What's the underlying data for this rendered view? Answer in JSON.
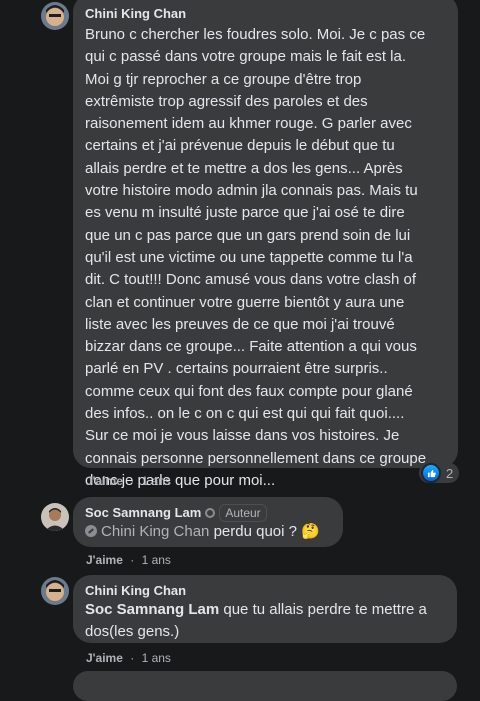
{
  "comments": [
    {
      "author": "Chini King Chan",
      "lines": [
        "Bruno c chercher les foudres solo. Moi. Je c pas ce",
        "qui c passé dans votre groupe mais le fait est la.",
        "Moi g tjr reprocher a ce groupe d'être trop",
        "extrêmiste trop agressif des paroles et des",
        "raisonement idem au khmer rouge. G parler avec",
        "certains et j'ai prévenue depuis le début que tu",
        "allais perdre et te mettre a dos les gens... Après",
        "votre histoire modo admin jla connais pas. Mais tu",
        "es venu m insulté juste parce que j'ai osé te dire",
        "que un c pas parce que un gars prend soin de lui",
        "qu'il est une victime ou une tappette comme tu l'a",
        "dit. C tout!!! Donc amusé vous dans votre clash of",
        "clan et continuer votre guerre bientôt y aura une",
        "liste avec les preuves de ce que moi j'ai trouvé",
        "bizzar dans ce groupe... Faite attention a qui vous",
        "parlé en PV . certains pourraient être surpris..",
        "comme ceux qui font des faux compte pour glané",
        "des infos.. on le c on c qui est qui qui fait quoi....",
        "Sur ce moi je vous laisse dans vos histoires. Je",
        "connais personne personnellement dans ce groupe",
        "donc je parle que pour moi..."
      ],
      "like_label": "J'aime",
      "time": "1 ans",
      "reaction_count": "2",
      "reaction_icon": "like-thumb-icon"
    },
    {
      "author": "Soc Samnang Lam",
      "author_badge": "Auteur",
      "mention": "Chini King Chan",
      "text": "perdu quoi ?",
      "emoji": "🤔",
      "like_label": "J'aime",
      "time": "1 ans"
    },
    {
      "author": "Chini King Chan",
      "mention": "Soc Samnang Lam",
      "line1": "que tu allais perdre te mettre a",
      "line2": "dos(les gens.)",
      "like_label": "J'aime",
      "time": "1 ans"
    }
  ],
  "separator": "·",
  "colors": {
    "background": "#18191a",
    "bubble": "#3a3b3c",
    "text": "#e4e6eb",
    "muted": "#b0b3b8",
    "like_blue": "#1877f2"
  }
}
